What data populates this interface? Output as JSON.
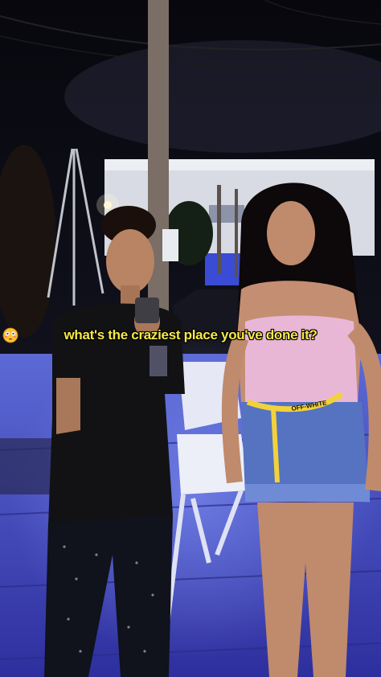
{
  "caption": {
    "text": "what's the craziest place you've done it?",
    "emoji_icon": "flushed-face-icon",
    "color": "#f5e94a"
  },
  "belt": {
    "text": "OFF-WHITE",
    "color": "#f2d23a"
  },
  "colors": {
    "sky": "#0b0b14",
    "wall_blue": "#4a56d8",
    "floor_blue": "#3b3fb8"
  }
}
